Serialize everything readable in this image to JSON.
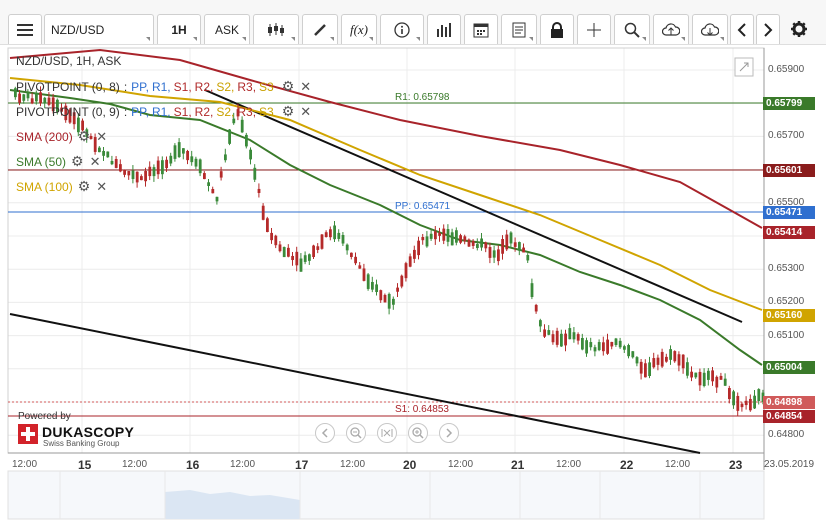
{
  "toolbar": {
    "menu_icon": "hamburger-icon",
    "symbol": "NZD/USD",
    "timeframe": "1H",
    "price_type": "ASK",
    "icons": [
      "candles-icon",
      "draw-pencil-icon",
      "function-icon",
      "info-icon",
      "bar-volume-icon",
      "calendar-icon",
      "notes-icon",
      "lock-icon",
      "crosshair-icon",
      "zoom-icon",
      "upload-cloud-icon",
      "download-cloud-icon",
      "chevron-left-icon",
      "chevron-right-icon",
      "gear-icon"
    ],
    "function_label": "f(x)"
  },
  "chart": {
    "title": "NZD/USD, 1H, ASK",
    "legend": [
      {
        "name": "PIVOTPOINT (0, 8)",
        "sep": ":",
        "items": [
          "PP,",
          "R1,",
          "S1,",
          "R2,",
          "S2,",
          "R3,",
          "S3"
        ],
        "colors": [
          "#2f6fcf",
          "#2f6fcf",
          "#b02a2a",
          "#b02a2a",
          "#c9a100",
          "#b02a2a",
          "#c9a100"
        ]
      },
      {
        "name": "PIVOTPOINT (0, 9)",
        "sep": ":",
        "items": [
          "PP,",
          "R1,",
          "S1,",
          "R2,",
          "S2,",
          "R3,",
          "S3"
        ],
        "colors": [
          "#2f6fcf",
          "#2f6fcf",
          "#b02a2a",
          "#b02a2a",
          "#c9a100",
          "#b02a2a",
          "#c9a100"
        ]
      },
      {
        "name": "SMA (200)",
        "color": "#a8232a"
      },
      {
        "name": "SMA (50)",
        "color": "#3a7a2a"
      },
      {
        "name": "SMA (100)",
        "color": "#d0a400"
      }
    ],
    "level_labels": {
      "r1": "R1: 0.65798",
      "pp": "PP: 0.65471",
      "s1": "S1: 0.64853"
    },
    "price_axis": [
      "0.65900",
      "0.65800",
      "0.65700",
      "0.65600",
      "0.65500",
      "0.65400",
      "0.65300",
      "0.65200",
      "0.65100",
      "0.65000",
      "0.64900",
      "0.64800"
    ],
    "price_tags": [
      {
        "value": "0.65799",
        "color": "#3a7a2a"
      },
      {
        "value": "0.65601",
        "color": "#8a1c1c"
      },
      {
        "value": "0.65471",
        "color": "#2f6fcf"
      },
      {
        "value": "0.65414",
        "color": "#a8232a"
      },
      {
        "value": "0.65160",
        "color": "#d0a400"
      },
      {
        "value": "0.65004",
        "color": "#3a7a2a"
      },
      {
        "value": "0.64898",
        "color": "#d05a5a"
      },
      {
        "value": "0.64854",
        "color": "#a8232a"
      }
    ],
    "time_axis": [
      {
        "label": "12:00",
        "big": false
      },
      {
        "label": "15",
        "big": true
      },
      {
        "label": "12:00",
        "big": false
      },
      {
        "label": "16",
        "big": true
      },
      {
        "label": "12:00",
        "big": false
      },
      {
        "label": "17",
        "big": true
      },
      {
        "label": "12:00",
        "big": false
      },
      {
        "label": "20",
        "big": true
      },
      {
        "label": "12:00",
        "big": false
      },
      {
        "label": "21",
        "big": true
      },
      {
        "label": "12:00",
        "big": false
      },
      {
        "label": "22",
        "big": true
      },
      {
        "label": "12:00",
        "big": false
      },
      {
        "label": "23",
        "big": true
      },
      {
        "label": "23.05.2019",
        "big": false
      }
    ],
    "powered_by": "Powered by",
    "brand": "DUKASCOPY",
    "brand_sub": "Swiss Banking Group",
    "nav_buttons": [
      "chevron-left-icon",
      "zoom-out-icon",
      "fit-icon",
      "zoom-in-icon",
      "chevron-right-icon"
    ],
    "colors": {
      "sma200": "#a8232a",
      "sma50": "#3a7a2a",
      "sma100": "#d0a400",
      "bull": "#3a8a3a",
      "bear": "#b52a2a"
    }
  }
}
